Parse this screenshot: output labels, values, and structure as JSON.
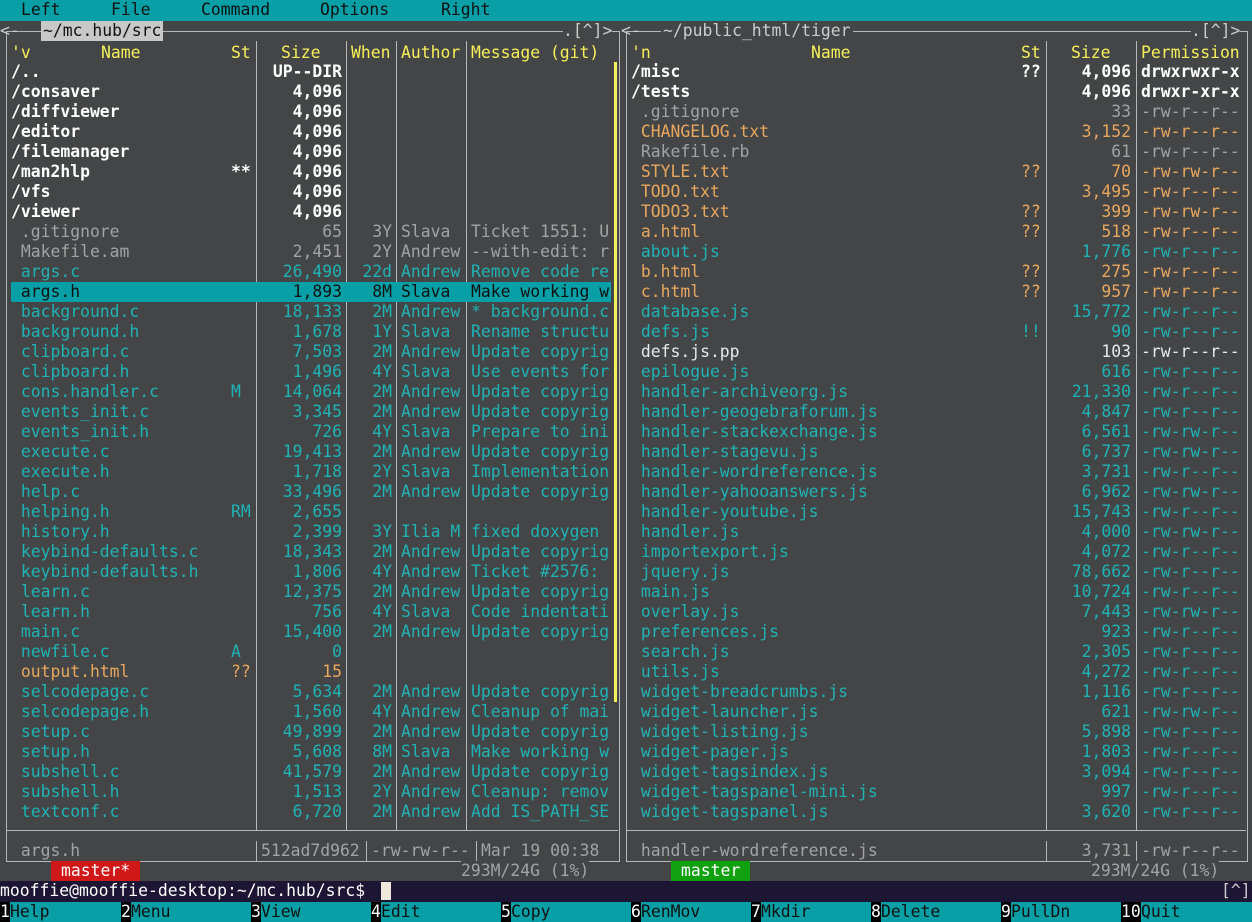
{
  "menubar": [
    "Left",
    "File",
    "Command",
    "Options",
    "Right"
  ],
  "left_panel": {
    "path": "~/mc.hub/src",
    "corner": ".[^]>",
    "headers": {
      "sort": "'v",
      "name": "Name",
      "st": "St",
      "size": "Size",
      "when": "When",
      "author": "Author",
      "message": "Message (git)"
    },
    "rows": [
      {
        "name": "/..",
        "st": "",
        "size": "UP--DIR",
        "when": "",
        "author": "",
        "message": "",
        "style": "dir"
      },
      {
        "name": "/consaver",
        "st": "",
        "size": "4,096",
        "when": "",
        "author": "",
        "message": "",
        "style": "dir"
      },
      {
        "name": "/diffviewer",
        "st": "",
        "size": "4,096",
        "when": "",
        "author": "",
        "message": "",
        "style": "dir"
      },
      {
        "name": "/editor",
        "st": "",
        "size": "4,096",
        "when": "",
        "author": "",
        "message": "",
        "style": "dir"
      },
      {
        "name": "/filemanager",
        "st": "",
        "size": "4,096",
        "when": "",
        "author": "",
        "message": "",
        "style": "dir"
      },
      {
        "name": "/man2hlp",
        "st": "**",
        "size": "4,096",
        "when": "",
        "author": "",
        "message": "",
        "style": "dir"
      },
      {
        "name": "/vfs",
        "st": "",
        "size": "4,096",
        "when": "",
        "author": "",
        "message": "",
        "style": "dir"
      },
      {
        "name": "/viewer",
        "st": "",
        "size": "4,096",
        "when": "",
        "author": "",
        "message": "",
        "style": "dir"
      },
      {
        "name": " .gitignore",
        "st": "",
        "size": "65",
        "when": "3Y",
        "author": "Slava",
        "message": "Ticket 1551: U",
        "style": "gray"
      },
      {
        "name": " Makefile.am",
        "st": "",
        "size": "2,451",
        "when": "2Y",
        "author": "Andrew",
        "message": "--with-edit: r",
        "style": "gray"
      },
      {
        "name": " args.c",
        "st": "",
        "size": "26,490",
        "when": "22d",
        "author": "Andrew",
        "message": "Remove code re",
        "style": "cyan"
      },
      {
        "name": " args.h",
        "st": "",
        "size": "1,893",
        "when": "8M",
        "author": "Slava",
        "message": "Make working w",
        "style": "sel"
      },
      {
        "name": " background.c",
        "st": "",
        "size": "18,133",
        "when": "2M",
        "author": "Andrew",
        "message": "* background.c",
        "style": "cyan"
      },
      {
        "name": " background.h",
        "st": "",
        "size": "1,678",
        "when": "1Y",
        "author": "Slava",
        "message": "Rename structu",
        "style": "cyan"
      },
      {
        "name": " clipboard.c",
        "st": "",
        "size": "7,503",
        "when": "2M",
        "author": "Andrew",
        "message": "Update copyrig",
        "style": "cyan"
      },
      {
        "name": " clipboard.h",
        "st": "",
        "size": "1,496",
        "when": "4Y",
        "author": "Slava",
        "message": "Use events for",
        "style": "cyan"
      },
      {
        "name": " cons.handler.c",
        "st": "M",
        "size": "14,064",
        "when": "2M",
        "author": "Andrew",
        "message": "Update copyrig",
        "style": "cyan"
      },
      {
        "name": " events_init.c",
        "st": "",
        "size": "3,345",
        "when": "2M",
        "author": "Andrew",
        "message": "Update copyrig",
        "style": "cyan"
      },
      {
        "name": " events_init.h",
        "st": "",
        "size": "726",
        "when": "4Y",
        "author": "Slava",
        "message": "Prepare to ini",
        "style": "cyan"
      },
      {
        "name": " execute.c",
        "st": "",
        "size": "19,413",
        "when": "2M",
        "author": "Andrew",
        "message": "Update copyrig",
        "style": "cyan"
      },
      {
        "name": " execute.h",
        "st": "",
        "size": "1,718",
        "when": "2Y",
        "author": "Slava",
        "message": "Implementation",
        "style": "cyan"
      },
      {
        "name": " help.c",
        "st": "",
        "size": "33,496",
        "when": "2M",
        "author": "Andrew",
        "message": "Update copyrig",
        "style": "cyan"
      },
      {
        "name": " helping.h",
        "st": "RM",
        "size": "2,655",
        "when": "",
        "author": "",
        "message": "",
        "style": "cyan"
      },
      {
        "name": " history.h",
        "st": "",
        "size": "2,399",
        "when": "3Y",
        "author": "Ilia M",
        "message": "fixed doxygen",
        "style": "cyan"
      },
      {
        "name": " keybind-defaults.c",
        "st": "",
        "size": "18,343",
        "when": "2M",
        "author": "Andrew",
        "message": "Update copyrig",
        "style": "cyan"
      },
      {
        "name": " keybind-defaults.h",
        "st": "",
        "size": "1,806",
        "when": "4Y",
        "author": "Andrew",
        "message": "Ticket #2576:",
        "style": "cyan"
      },
      {
        "name": " learn.c",
        "st": "",
        "size": "12,375",
        "when": "2M",
        "author": "Andrew",
        "message": "Update copyrig",
        "style": "cyan"
      },
      {
        "name": " learn.h",
        "st": "",
        "size": "756",
        "when": "4Y",
        "author": "Slava",
        "message": "Code indentati",
        "style": "cyan"
      },
      {
        "name": " main.c",
        "st": "",
        "size": "15,400",
        "when": "2M",
        "author": "Andrew",
        "message": "Update copyrig",
        "style": "cyan"
      },
      {
        "name": " newfile.c",
        "st": "A",
        "size": "0",
        "when": "",
        "author": "",
        "message": "",
        "style": "cyan"
      },
      {
        "name": " output.html",
        "st": "??",
        "size": "15",
        "when": "",
        "author": "",
        "message": "",
        "style": "orange"
      },
      {
        "name": " selcodepage.c",
        "st": "",
        "size": "5,634",
        "when": "2M",
        "author": "Andrew",
        "message": "Update copyrig",
        "style": "cyan"
      },
      {
        "name": " selcodepage.h",
        "st": "",
        "size": "1,560",
        "when": "4Y",
        "author": "Andrew",
        "message": "Cleanup of mai",
        "style": "cyan"
      },
      {
        "name": " setup.c",
        "st": "",
        "size": "49,899",
        "when": "2M",
        "author": "Andrew",
        "message": "Update copyrig",
        "style": "cyan"
      },
      {
        "name": " setup.h",
        "st": "",
        "size": "5,608",
        "when": "8M",
        "author": "Slava",
        "message": "Make working w",
        "style": "cyan"
      },
      {
        "name": " subshell.c",
        "st": "",
        "size": "41,579",
        "when": "2M",
        "author": "Andrew",
        "message": "Update copyrig",
        "style": "cyan"
      },
      {
        "name": " subshell.h",
        "st": "",
        "size": "1,513",
        "when": "2Y",
        "author": "Andrew",
        "message": "Cleanup: remov",
        "style": "cyan"
      },
      {
        "name": " textconf.c",
        "st": "",
        "size": "6,720",
        "when": "2M",
        "author": "Andrew",
        "message": "Add IS_PATH_SE",
        "style": "cyan"
      }
    ],
    "status": {
      "name": " args.h",
      "hash": "512ad7d962",
      "perm": "-rw-rw-r--",
      "date": "Mar 19 00:38"
    },
    "branch": "master*",
    "disk": "293M/24G (1%)"
  },
  "right_panel": {
    "path": "~/public_html/tiger",
    "corner": ".[^]>",
    "headers": {
      "sort": "'n",
      "name": "Name",
      "st": "St",
      "size": "Size",
      "perm": "Permission"
    },
    "rows": [
      {
        "name": "/misc",
        "st": "??",
        "size": "4,096",
        "perm": "drwxrwxr-x",
        "style": "dir"
      },
      {
        "name": "/tests",
        "st": "",
        "size": "4,096",
        "perm": "drwxr-xr-x",
        "style": "dir"
      },
      {
        "name": " .gitignore",
        "st": "",
        "size": "33",
        "perm": "-rw-r--r--",
        "style": "gray"
      },
      {
        "name": " CHANGELOG.txt",
        "st": "",
        "size": "3,152",
        "perm": "-rw-r--r--",
        "style": "orange"
      },
      {
        "name": " Rakefile.rb",
        "st": "",
        "size": "61",
        "perm": "-rw-r--r--",
        "style": "gray"
      },
      {
        "name": " STYLE.txt",
        "st": "??",
        "size": "70",
        "perm": "-rw-rw-r--",
        "style": "orange"
      },
      {
        "name": " TODO.txt",
        "st": "",
        "size": "3,495",
        "perm": "-rw-r--r--",
        "style": "orange"
      },
      {
        "name": " TODO3.txt",
        "st": "??",
        "size": "399",
        "perm": "-rw-rw-r--",
        "style": "orange"
      },
      {
        "name": " a.html",
        "st": "??",
        "size": "518",
        "perm": "-rw-r--r--",
        "style": "orange"
      },
      {
        "name": " about.js",
        "st": "",
        "size": "1,776",
        "perm": "-rw-r--r--",
        "style": "cyan"
      },
      {
        "name": " b.html",
        "st": "??",
        "size": "275",
        "perm": "-rw-r--r--",
        "style": "orange"
      },
      {
        "name": " c.html",
        "st": "??",
        "size": "957",
        "perm": "-rw-r--r--",
        "style": "orange"
      },
      {
        "name": " database.js",
        "st": "",
        "size": "15,772",
        "perm": "-rw-r--r--",
        "style": "cyan"
      },
      {
        "name": " defs.js",
        "st": "!!",
        "size": "90",
        "perm": "-rw-r--r--",
        "style": "cyan"
      },
      {
        "name": " defs.js.pp",
        "st": "",
        "size": "103",
        "perm": "-rw-r--r--",
        "style": "white"
      },
      {
        "name": " epilogue.js",
        "st": "",
        "size": "616",
        "perm": "-rw-r--r--",
        "style": "cyan"
      },
      {
        "name": " handler-archiveorg.js",
        "st": "",
        "size": "21,330",
        "perm": "-rw-r--r--",
        "style": "cyan"
      },
      {
        "name": " handler-geogebraforum.js",
        "st": "",
        "size": "4,847",
        "perm": "-rw-r--r--",
        "style": "cyan"
      },
      {
        "name": " handler-stackexchange.js",
        "st": "",
        "size": "6,561",
        "perm": "-rw-rw-r--",
        "style": "cyan"
      },
      {
        "name": " handler-stagevu.js",
        "st": "",
        "size": "6,737",
        "perm": "-rw-rw-r--",
        "style": "cyan"
      },
      {
        "name": " handler-wordreference.js",
        "st": "",
        "size": "3,731",
        "perm": "-rw-r--r--",
        "style": "cyan"
      },
      {
        "name": " handler-yahooanswers.js",
        "st": "",
        "size": "6,962",
        "perm": "-rw-rw-r--",
        "style": "cyan"
      },
      {
        "name": " handler-youtube.js",
        "st": "",
        "size": "15,743",
        "perm": "-rw-r--r--",
        "style": "cyan"
      },
      {
        "name": " handler.js",
        "st": "",
        "size": "4,000",
        "perm": "-rw-rw-r--",
        "style": "cyan"
      },
      {
        "name": " importexport.js",
        "st": "",
        "size": "4,072",
        "perm": "-rw-r--r--",
        "style": "cyan"
      },
      {
        "name": " jquery.js",
        "st": "",
        "size": "78,662",
        "perm": "-rw-r--r--",
        "style": "cyan"
      },
      {
        "name": " main.js",
        "st": "",
        "size": "10,724",
        "perm": "-rw-r--r--",
        "style": "cyan"
      },
      {
        "name": " overlay.js",
        "st": "",
        "size": "7,443",
        "perm": "-rw-rw-r--",
        "style": "cyan"
      },
      {
        "name": " preferences.js",
        "st": "",
        "size": "923",
        "perm": "-rw-r--r--",
        "style": "cyan"
      },
      {
        "name": " search.js",
        "st": "",
        "size": "2,305",
        "perm": "-rw-r--r--",
        "style": "cyan"
      },
      {
        "name": " utils.js",
        "st": "",
        "size": "4,272",
        "perm": "-rw-r--r--",
        "style": "cyan"
      },
      {
        "name": " widget-breadcrumbs.js",
        "st": "",
        "size": "1,116",
        "perm": "-rw-r--r--",
        "style": "cyan"
      },
      {
        "name": " widget-launcher.js",
        "st": "",
        "size": "621",
        "perm": "-rw-rw-r--",
        "style": "cyan"
      },
      {
        "name": " widget-listing.js",
        "st": "",
        "size": "5,898",
        "perm": "-rw-r--r--",
        "style": "cyan"
      },
      {
        "name": " widget-pager.js",
        "st": "",
        "size": "1,803",
        "perm": "-rw-r--r--",
        "style": "cyan"
      },
      {
        "name": " widget-tagsindex.js",
        "st": "",
        "size": "3,094",
        "perm": "-rw-r--r--",
        "style": "cyan"
      },
      {
        "name": " widget-tagspanel-mini.js",
        "st": "",
        "size": "997",
        "perm": "-rw-r--r--",
        "style": "cyan"
      },
      {
        "name": " widget-tagspanel.js",
        "st": "",
        "size": "3,620",
        "perm": "-rw-r--r--",
        "style": "cyan"
      }
    ],
    "status": {
      "name": " handler-wordreference.js",
      "size": "3,731",
      "perm": "-rw-r--r--"
    },
    "branch": "master",
    "disk": "293M/24G (1%)"
  },
  "command_line": {
    "prompt": "mooffie@mooffie-desktop:~/mc.hub/src$",
    "value": "",
    "corner": "[^]"
  },
  "function_keys": [
    {
      "n": "1",
      "label": "Help"
    },
    {
      "n": "2",
      "label": "Menu"
    },
    {
      "n": "3",
      "label": "View"
    },
    {
      "n": "4",
      "label": "Edit"
    },
    {
      "n": "5",
      "label": "Copy"
    },
    {
      "n": "6",
      "label": "RenMov"
    },
    {
      "n": "7",
      "label": "Mkdir"
    },
    {
      "n": "8",
      "label": "Delete"
    },
    {
      "n": "9",
      "label": "PullDn"
    },
    {
      "n": "10",
      "label": "Quit"
    }
  ],
  "colors": {
    "accent": "#08a0a6",
    "background": "#444546",
    "header": "#f5f05a",
    "dir": "#ffffff",
    "cyan": "#1fb3b5",
    "orange": "#e8a75e",
    "branch_left": "#d01818",
    "branch_right": "#10a010"
  }
}
